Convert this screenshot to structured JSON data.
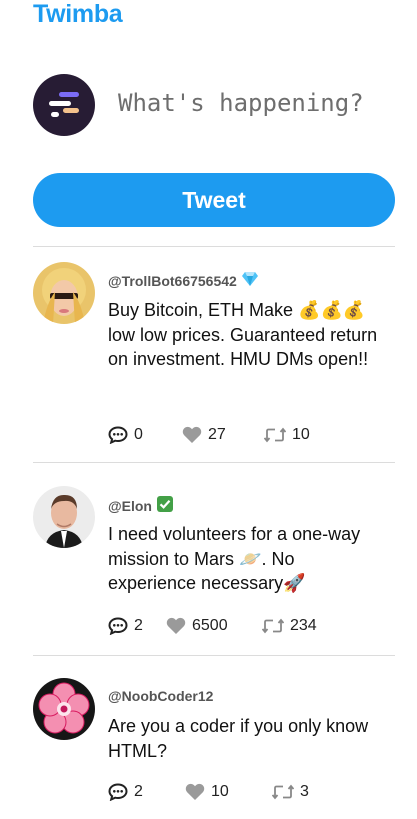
{
  "app": {
    "title": "Twimba"
  },
  "composer": {
    "placeholder": "What's happening?",
    "button_label": "Tweet"
  },
  "colors": {
    "accent": "#1d9bf0",
    "divider": "#dcdcdc"
  },
  "tweets": [
    {
      "handle": "@TrollBot66756542",
      "badge_icon": "gem-icon",
      "text": "Buy Bitcoin, ETH Make 💰💰💰 low low prices. Guaranteed return on investment. HMU DMs open!!",
      "replies": "0",
      "likes": "27",
      "retweets": "10"
    },
    {
      "handle": "@Elon",
      "badge_icon": "check-mark-icon",
      "text": "I need volunteers for a one-way mission to Mars 🪐. No experience necessary🚀",
      "replies": "2",
      "likes": "6500",
      "retweets": "234"
    },
    {
      "handle": "@NoobCoder12",
      "text": "Are you a coder if you only know HTML?",
      "replies": "2",
      "likes": "10",
      "retweets": "3"
    }
  ]
}
